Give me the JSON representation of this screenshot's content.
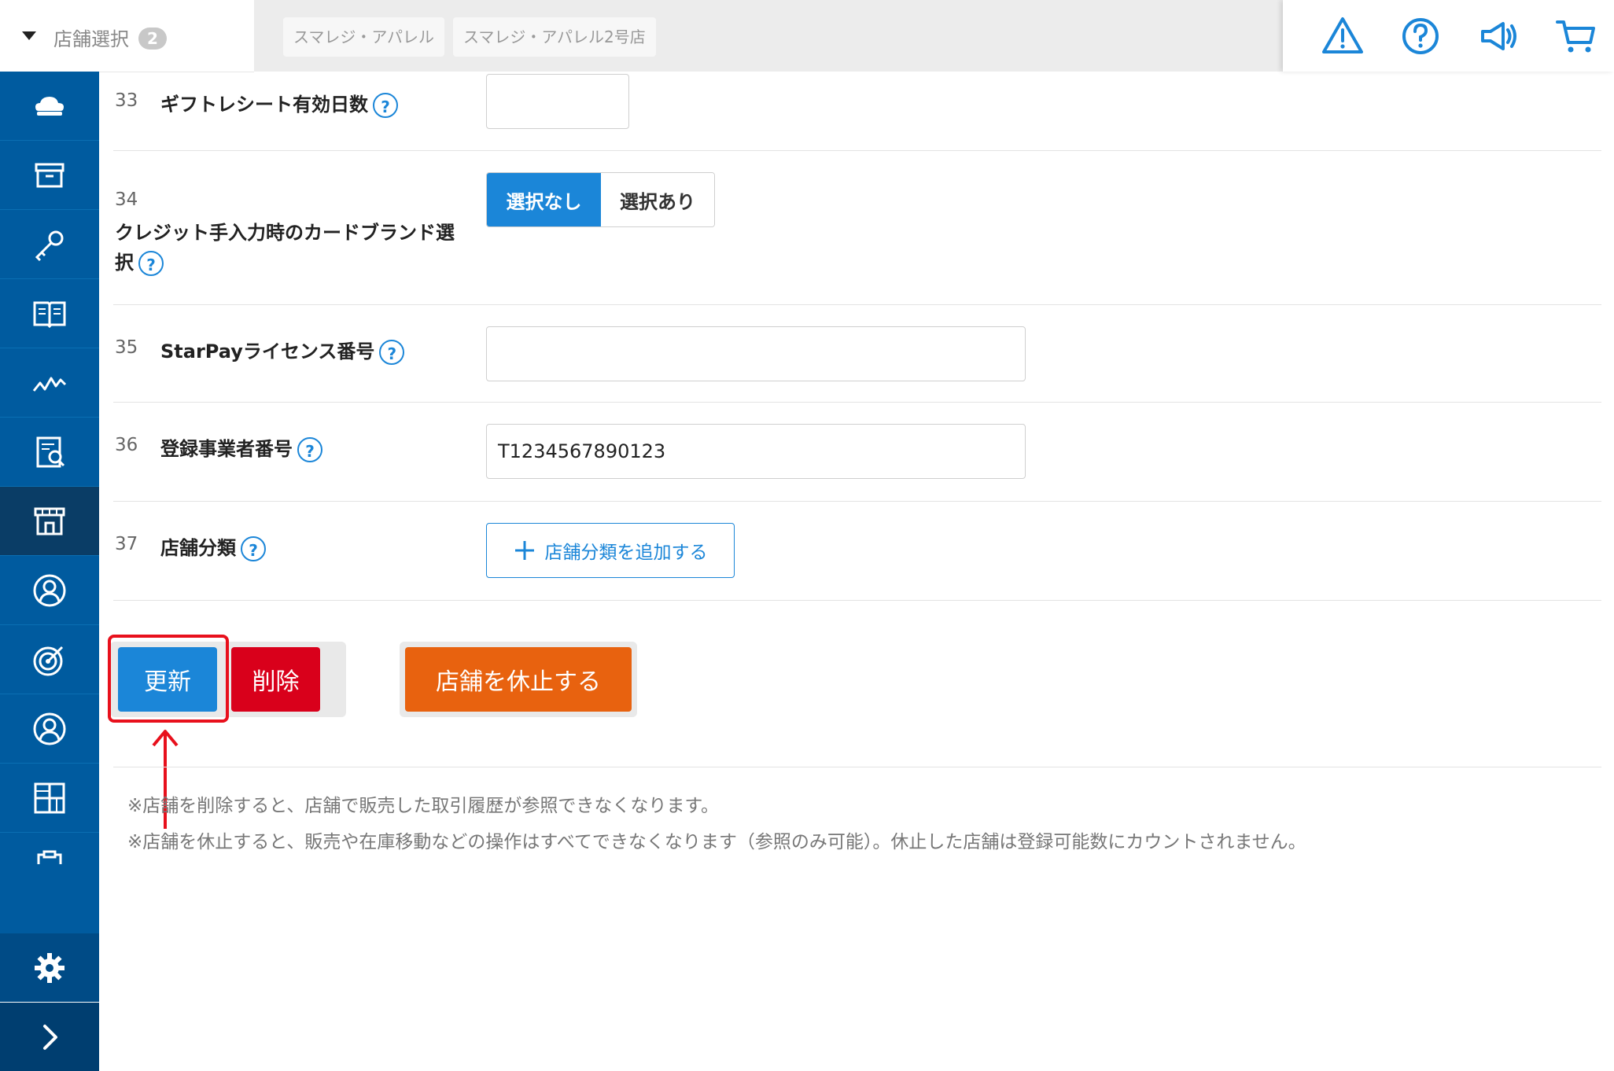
{
  "topbar": {
    "store_select_label": "店舗選択",
    "store_count": "2",
    "stores": [
      "スマレジ・アパレル",
      "スマレジ・アパレル2号店"
    ]
  },
  "top_icons": [
    "warning-icon",
    "help-icon",
    "announcement-icon",
    "cart-icon"
  ],
  "sidebar_icons": [
    "cloud-icon",
    "box-icon",
    "key-icon",
    "book-icon",
    "chart-icon",
    "report-icon",
    "store-icon",
    "customer-icon",
    "target-icon",
    "user-icon",
    "grid-icon",
    "clipboard-icon",
    "gear-icon",
    "chevron-right-icon"
  ],
  "fields": [
    {
      "num": "33",
      "label": "ギフトレシート有効日数",
      "help": "?",
      "value": ""
    },
    {
      "num": "34",
      "label_line1": "クレジット手入力時のカードブランド選",
      "label_line2": "択",
      "help": "?",
      "option_off": "選択なし",
      "option_on": "選択あり",
      "selected": "選択なし"
    },
    {
      "num": "35",
      "label": "StarPayライセンス番号",
      "help": "?",
      "value": ""
    },
    {
      "num": "36",
      "label": "登録事業者番号",
      "help": "?",
      "value": "T1234567890123"
    },
    {
      "num": "37",
      "label": "店舗分類",
      "help": "?",
      "add_label": "店舗分類を追加する"
    }
  ],
  "actions": {
    "update": "更新",
    "delete": "削除",
    "suspend": "店舗を休止する"
  },
  "notes": [
    "※店舗を削除すると、店舗で販売した取引履歴が参照できなくなります。",
    "※店舗を休止すると、販売や在庫移動などの操作はすべてできなくなります（参照のみ可能）。休止した店舗は登録可能数にカウントされません。"
  ],
  "colors": {
    "primary": "#1b86d8",
    "sidebar": "#005b9f",
    "danger": "#d9001b",
    "warning": "#e8620f",
    "highlight": "#e8101c"
  }
}
